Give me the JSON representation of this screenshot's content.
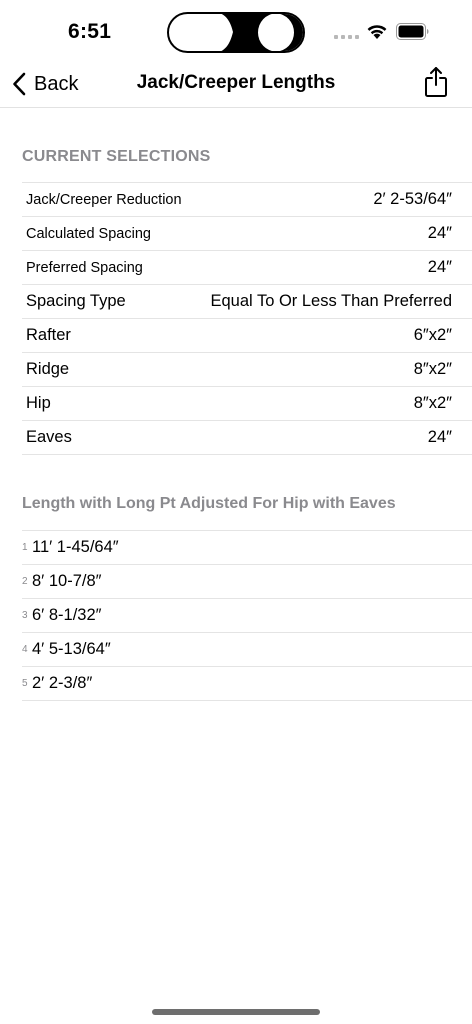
{
  "status": {
    "time": "6:51"
  },
  "nav": {
    "back_label": "Back",
    "title": "Jack/Creeper Lengths"
  },
  "current_selections": {
    "header": "CURRENT SELECTIONS",
    "rows": [
      {
        "label": "Jack/Creeper Reduction",
        "value": "2′ 2-53/64″"
      },
      {
        "label": "Calculated Spacing",
        "value": "24″"
      },
      {
        "label": "Preferred Spacing",
        "value": "24″"
      },
      {
        "label": "Spacing Type",
        "value": "Equal To Or Less Than Preferred"
      },
      {
        "label": "Rafter",
        "value": "6″x2″"
      },
      {
        "label": "Ridge",
        "value": "8″x2″"
      },
      {
        "label": "Hip",
        "value": "8″x2″"
      },
      {
        "label": "Eaves",
        "value": "24″"
      }
    ]
  },
  "lengths": {
    "header": "Length with Long Pt Adjusted For Hip with Eaves",
    "items": [
      {
        "index": "1",
        "value": "11′ 1-45/64″"
      },
      {
        "index": "2",
        "value": "8′ 10-7/8″"
      },
      {
        "index": "3",
        "value": "6′ 8-1/32″"
      },
      {
        "index": "4",
        "value": "4′ 5-13/64″"
      },
      {
        "index": "5",
        "value": "2′ 2-3/8″"
      }
    ]
  },
  "icons": {
    "back": "chevron-left-icon",
    "share": "share-icon",
    "wifi": "wifi-icon",
    "battery": "battery-icon"
  }
}
